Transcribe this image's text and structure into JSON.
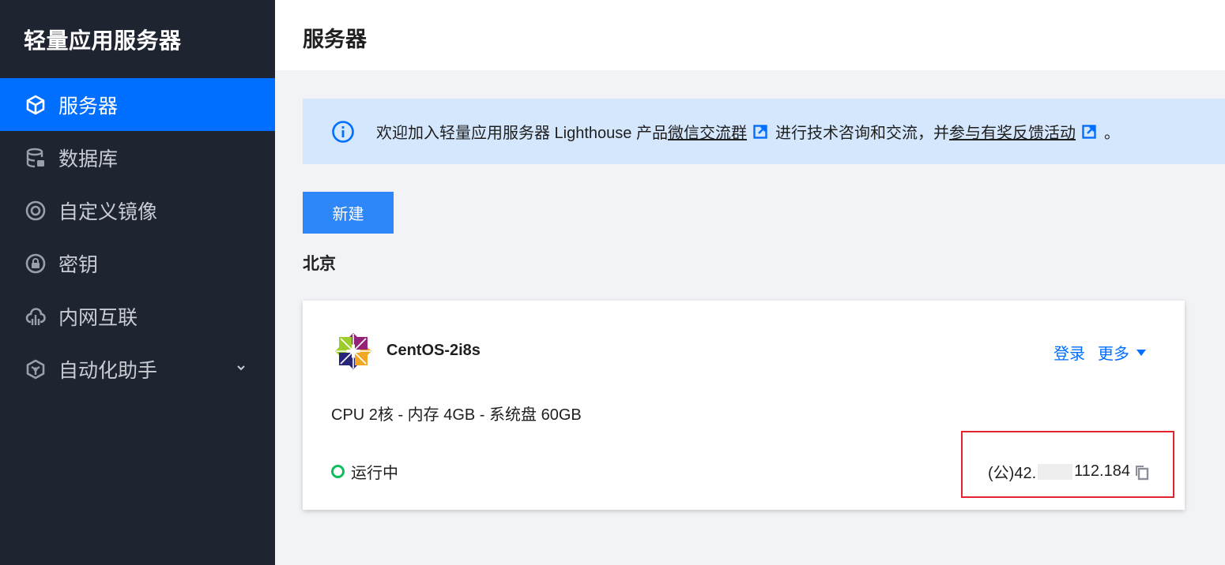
{
  "brand": "轻量应用服务器",
  "sidebar": {
    "items": [
      {
        "label": "服务器",
        "icon": "cube-icon",
        "active": true
      },
      {
        "label": "数据库",
        "icon": "database-icon"
      },
      {
        "label": "自定义镜像",
        "icon": "image-disc-icon"
      },
      {
        "label": "密钥",
        "icon": "key-lock-icon"
      },
      {
        "label": "内网互联",
        "icon": "cloud-network-icon"
      },
      {
        "label": "自动化助手",
        "icon": "automation-icon",
        "expandable": true
      }
    ]
  },
  "header": {
    "title": "服务器"
  },
  "notice": {
    "text_1": "欢迎加入轻量应用服务器 Lighthouse 产品 ",
    "link_1": "微信交流群",
    "text_2": "进行技术咨询和交流，并",
    "link_2": "参与有奖反馈活动",
    "text_3": "。"
  },
  "toolbar": {
    "new_label": "新建"
  },
  "region": "北京",
  "server": {
    "name": "CentOS-2i8s",
    "login_label": "登录",
    "more_label": "更多",
    "specs": "CPU 2核 - 内存 4GB - 系统盘 60GB",
    "status": "运行中",
    "ip_prefix": "(公)42.",
    "ip_suffix": "112.184"
  },
  "colors": {
    "sidebar_bg": "#1f2431",
    "accent": "#006eff",
    "status_running": "#0abf5b",
    "highlight_box": "#e5232f"
  }
}
